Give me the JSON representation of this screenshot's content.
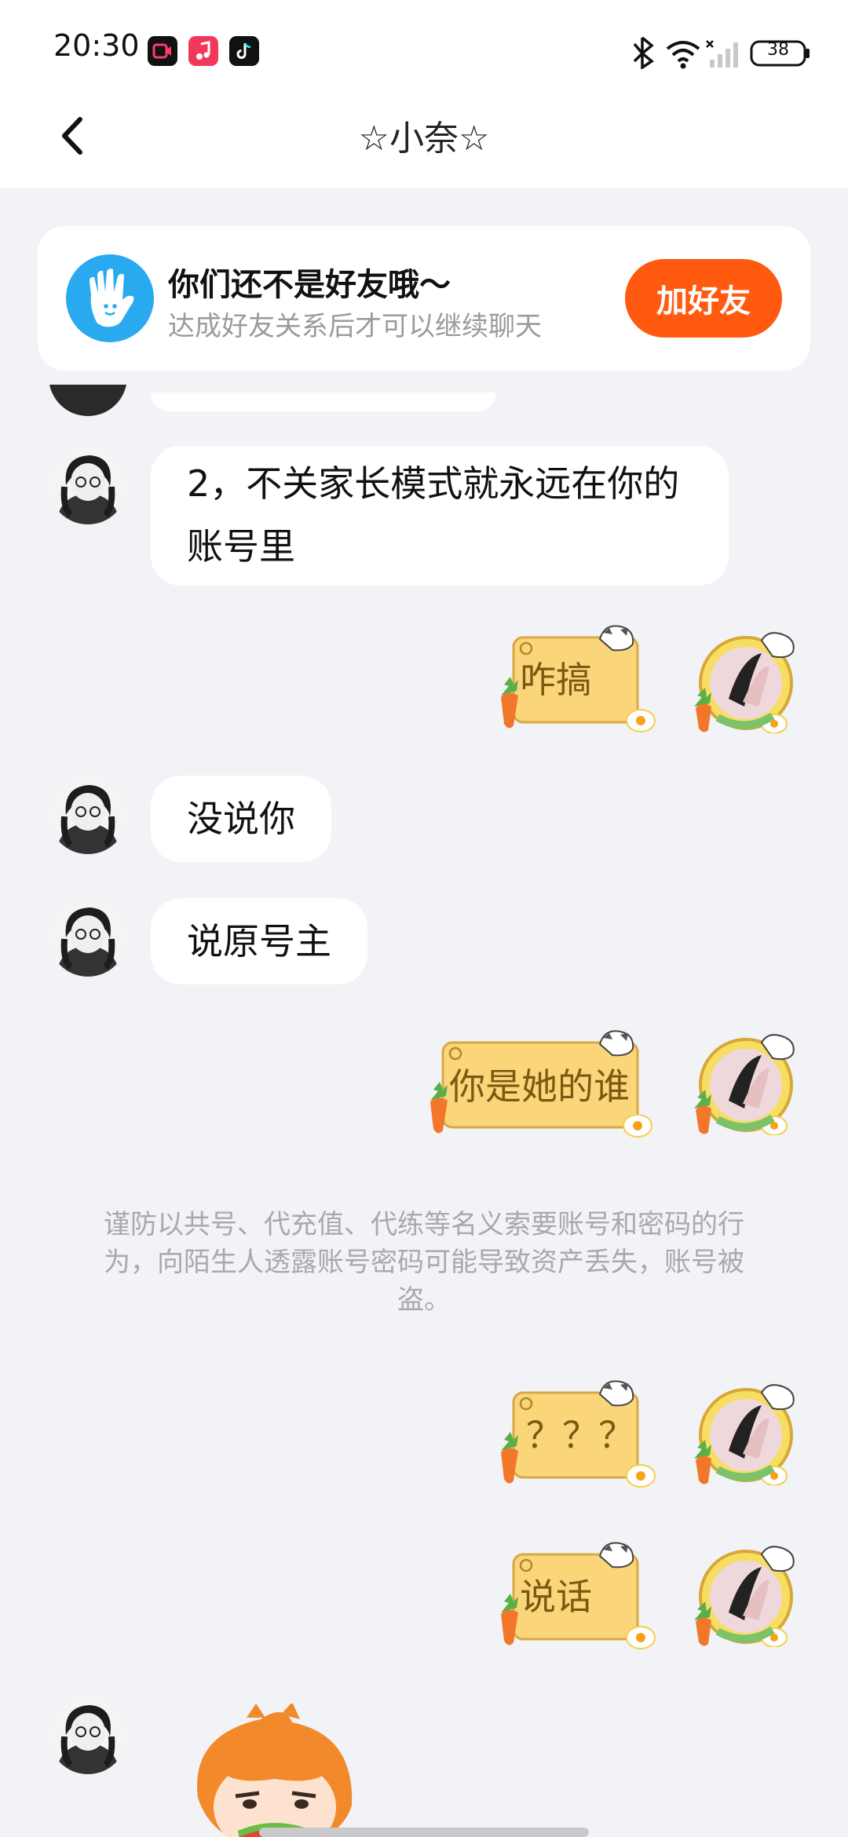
{
  "status_bar": {
    "time": "20:30",
    "battery": "38",
    "icons": [
      "screen-recorder-app-icon",
      "music-app-icon",
      "tiktok-app-icon",
      "bluetooth-icon",
      "wifi-icon",
      "signal-icon",
      "battery-icon"
    ]
  },
  "header": {
    "title": "☆小奈☆",
    "back_icon": "chevron-left-icon"
  },
  "friend_banner": {
    "title": "你们还不是好友哦～",
    "subtitle": "达成好友关系后才可以继续聊天",
    "button": "加好友",
    "icon": "hand-wave-icon",
    "accent": "#ff5a0f",
    "icon_color": "#29aaf0"
  },
  "messages": [
    {
      "side": "left",
      "text": "2，不关家长模式就永远在你的\n账号里"
    },
    {
      "side": "right",
      "sticker_text": "咋搞"
    },
    {
      "side": "left",
      "text": "没说你"
    },
    {
      "side": "left",
      "text": "说原号主"
    },
    {
      "side": "right",
      "sticker_text": "你是她的谁"
    },
    {
      "side": "right",
      "sticker_text": "？？？"
    },
    {
      "side": "right",
      "sticker_text": "说话"
    },
    {
      "side": "left",
      "sticker": "cartoon-girl-sticker"
    }
  ],
  "security_notice": "谨防以共号、代充值、代练等名义索要账号和密码的行为，向陌生人透露账号密码可能导致资产丢失，账号被盗。"
}
